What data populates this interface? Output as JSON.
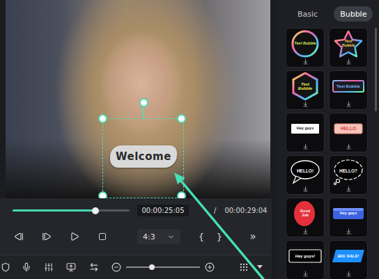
{
  "player": {
    "overlay_text": "Welcome",
    "progress": {
      "level": 0.71
    },
    "current_time": "00:00:25:05",
    "separator": "/",
    "total_time": "00:00:29:04"
  },
  "controls": {
    "aspect": "4:3",
    "mark_in": "{",
    "mark_out": "}",
    "more": "»"
  },
  "zoom": {
    "level": 0.35
  },
  "tabs": [
    {
      "label": "Basic",
      "selected": false
    },
    {
      "label": "Bubble",
      "selected": true
    }
  ],
  "bubbles": [
    {
      "label": "Text Bubble",
      "kind": "ring",
      "color": "#d7f25a"
    },
    {
      "label": "Text Bubble",
      "kind": "star",
      "color": "#f2d35a"
    },
    {
      "label": "Text Bubble",
      "kind": "hexagon",
      "color": "#e8f04a"
    },
    {
      "label": "Text Bubble",
      "kind": "pill",
      "color": "#7fb8ff"
    },
    {
      "label": "Hey guys",
      "kind": "note",
      "color": "#ffffff"
    },
    {
      "label": "HELLO",
      "kind": "tag",
      "color": "#f4c3bb"
    },
    {
      "label": "HELLO!",
      "kind": "speech",
      "color": "#ffffff"
    },
    {
      "label": "HELLO?",
      "kind": "cloud",
      "color": "#ffffff"
    },
    {
      "label": "Good Job",
      "kind": "blob",
      "color": "#e4303a"
    },
    {
      "label": "Hey guys",
      "kind": "bar",
      "color": "#3b63e0"
    },
    {
      "label": "Hey guys!",
      "kind": "frame",
      "color": "#ffffff"
    },
    {
      "label": "BIG SALE!",
      "kind": "badge",
      "color": "#1e8fff"
    }
  ]
}
